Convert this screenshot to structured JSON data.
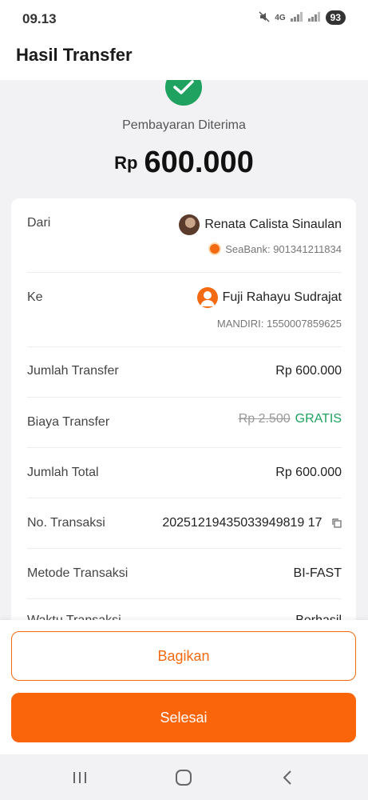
{
  "status_bar": {
    "time": "09.13",
    "network": "4G",
    "battery": "93"
  },
  "header": {
    "title": "Hasil Transfer"
  },
  "receipt": {
    "status": "Pembayaran Diterima",
    "currency": "Rp",
    "amount": "600.000"
  },
  "details": {
    "from_label": "Dari",
    "from_name": "Renata Calista Sinaulan",
    "from_account": "SeaBank: 901341211834",
    "to_label": "Ke",
    "to_name": "Fuji Rahayu Sudrajat",
    "to_account": "MANDIRI: 1550007859625",
    "amount_label": "Jumlah Transfer",
    "amount_value": "Rp 600.000",
    "fee_label": "Biaya Transfer",
    "fee_original": "Rp 2.500",
    "fee_value": "GRATIS",
    "total_label": "Jumlah Total",
    "total_value": "Rp 600.000",
    "txn_label": "No. Transaksi",
    "txn_value": "20251219435033949819 17",
    "method_label": "Metode Transaksi",
    "method_value": "BI-FAST",
    "time_label": "Waktu Transaksi",
    "time_value": "Berhasil"
  },
  "actions": {
    "share": "Bagikan",
    "done": "Selesai"
  },
  "icons": {
    "success": "check-circle-icon",
    "copy": "copy-icon",
    "nav_recent": "recent-apps-icon",
    "nav_home": "home-icon",
    "nav_back": "back-icon"
  },
  "colors": {
    "brand": "#fa640a",
    "success": "#1fa160"
  }
}
